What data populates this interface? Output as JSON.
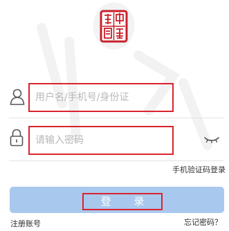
{
  "logo": {
    "seal_text": "中國國際",
    "icon": "red-seal-logo"
  },
  "form": {
    "username_placeholder": "用户名/手机号/身份证",
    "password_placeholder": "请输入密码",
    "username_icon": "user-icon",
    "password_icon": "lock-icon",
    "visibility_icon": "eye-closed-icon"
  },
  "links": {
    "sms_login": "手机验证码登录",
    "register": "注册账号",
    "forgot_password": "忘记密码？"
  },
  "buttons": {
    "login_label": "登 录"
  },
  "colors": {
    "accent_red": "#d9232d",
    "button_blue": "#a9c8ee",
    "placeholder_gray": "#b8b8b8"
  }
}
